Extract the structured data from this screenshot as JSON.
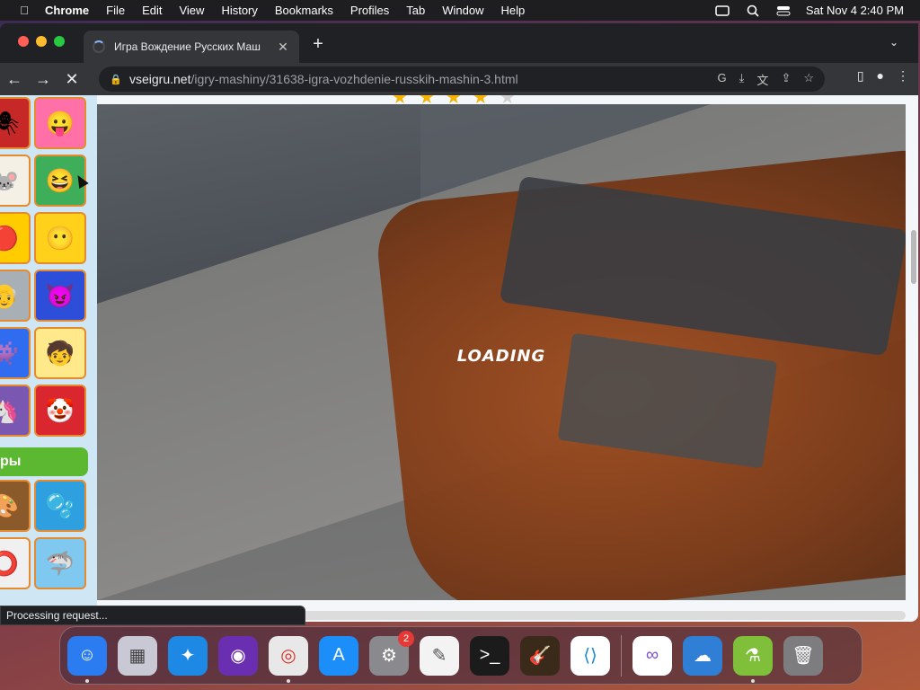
{
  "menubar": {
    "app": "Chrome",
    "items": [
      "File",
      "Edit",
      "View",
      "History",
      "Bookmarks",
      "Profiles",
      "Tab",
      "Window",
      "Help"
    ],
    "clock": "Sat Nov 4  2:40 PM",
    "icons": [
      "apple-icon",
      "screen-mirror-icon",
      "search-icon",
      "control-center-icon"
    ]
  },
  "browser": {
    "tab_title": "Игра Вождение Русских Маш",
    "url_host": "vseigru.net",
    "url_path": "/igry-mashiny/31638-igra-vozhdenie-russkih-mashin-3.html",
    "status": "Processing request..."
  },
  "page": {
    "section_label": "ры",
    "loading_text": "LOADING",
    "rating_stars": 4,
    "rating_max": 5
  },
  "dock": {
    "apps": [
      {
        "name": "Finder",
        "icon": "finder-icon",
        "color": "#2a7cf0"
      },
      {
        "name": "Launchpad",
        "icon": "launchpad-icon",
        "color": "#c9c9d6"
      },
      {
        "name": "Safari",
        "icon": "safari-icon",
        "color": "#1e88e5"
      },
      {
        "name": "Firefox",
        "icon": "firefox-icon",
        "color": "#6a2fb0"
      },
      {
        "name": "Chrome",
        "icon": "chrome-icon",
        "color": "#e8e8e8"
      },
      {
        "name": "App Store",
        "icon": "appstore-icon",
        "color": "#1c8ef9"
      },
      {
        "name": "System Settings",
        "icon": "settings-icon",
        "color": "#8a8a8e",
        "badge": "2"
      },
      {
        "name": "TextEdit",
        "icon": "textedit-icon",
        "color": "#f3f3f3"
      },
      {
        "name": "Terminal",
        "icon": "terminal-icon",
        "color": "#1b1b1b"
      },
      {
        "name": "GarageBand",
        "icon": "garageband-icon",
        "color": "#3a2a1a"
      },
      {
        "name": "VS Code",
        "icon": "vscode-icon",
        "color": "#ffffff"
      },
      {
        "name": "Visual Studio",
        "icon": "visualstudio-icon",
        "color": "#ffffff"
      },
      {
        "name": "Weather",
        "icon": "weather-icon",
        "color": "#2f7fd6"
      },
      {
        "name": "Potion",
        "icon": "potion-icon",
        "color": "#7fbf3a"
      },
      {
        "name": "Trash",
        "icon": "trash-icon",
        "color": "#7d7d80"
      }
    ]
  }
}
